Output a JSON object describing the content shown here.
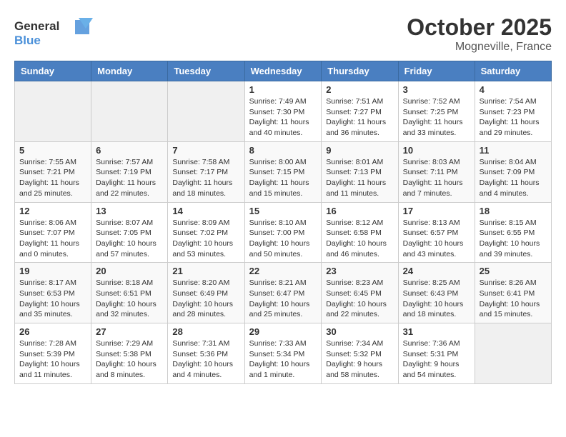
{
  "header": {
    "logo_general": "General",
    "logo_blue": "Blue",
    "month": "October 2025",
    "location": "Mogneville, France"
  },
  "weekdays": [
    "Sunday",
    "Monday",
    "Tuesday",
    "Wednesday",
    "Thursday",
    "Friday",
    "Saturday"
  ],
  "weeks": [
    [
      {
        "day": "",
        "info": ""
      },
      {
        "day": "",
        "info": ""
      },
      {
        "day": "",
        "info": ""
      },
      {
        "day": "1",
        "info": "Sunrise: 7:49 AM\nSunset: 7:30 PM\nDaylight: 11 hours and 40 minutes."
      },
      {
        "day": "2",
        "info": "Sunrise: 7:51 AM\nSunset: 7:27 PM\nDaylight: 11 hours and 36 minutes."
      },
      {
        "day": "3",
        "info": "Sunrise: 7:52 AM\nSunset: 7:25 PM\nDaylight: 11 hours and 33 minutes."
      },
      {
        "day": "4",
        "info": "Sunrise: 7:54 AM\nSunset: 7:23 PM\nDaylight: 11 hours and 29 minutes."
      }
    ],
    [
      {
        "day": "5",
        "info": "Sunrise: 7:55 AM\nSunset: 7:21 PM\nDaylight: 11 hours and 25 minutes."
      },
      {
        "day": "6",
        "info": "Sunrise: 7:57 AM\nSunset: 7:19 PM\nDaylight: 11 hours and 22 minutes."
      },
      {
        "day": "7",
        "info": "Sunrise: 7:58 AM\nSunset: 7:17 PM\nDaylight: 11 hours and 18 minutes."
      },
      {
        "day": "8",
        "info": "Sunrise: 8:00 AM\nSunset: 7:15 PM\nDaylight: 11 hours and 15 minutes."
      },
      {
        "day": "9",
        "info": "Sunrise: 8:01 AM\nSunset: 7:13 PM\nDaylight: 11 hours and 11 minutes."
      },
      {
        "day": "10",
        "info": "Sunrise: 8:03 AM\nSunset: 7:11 PM\nDaylight: 11 hours and 7 minutes."
      },
      {
        "day": "11",
        "info": "Sunrise: 8:04 AM\nSunset: 7:09 PM\nDaylight: 11 hours and 4 minutes."
      }
    ],
    [
      {
        "day": "12",
        "info": "Sunrise: 8:06 AM\nSunset: 7:07 PM\nDaylight: 11 hours and 0 minutes."
      },
      {
        "day": "13",
        "info": "Sunrise: 8:07 AM\nSunset: 7:05 PM\nDaylight: 10 hours and 57 minutes."
      },
      {
        "day": "14",
        "info": "Sunrise: 8:09 AM\nSunset: 7:02 PM\nDaylight: 10 hours and 53 minutes."
      },
      {
        "day": "15",
        "info": "Sunrise: 8:10 AM\nSunset: 7:00 PM\nDaylight: 10 hours and 50 minutes."
      },
      {
        "day": "16",
        "info": "Sunrise: 8:12 AM\nSunset: 6:58 PM\nDaylight: 10 hours and 46 minutes."
      },
      {
        "day": "17",
        "info": "Sunrise: 8:13 AM\nSunset: 6:57 PM\nDaylight: 10 hours and 43 minutes."
      },
      {
        "day": "18",
        "info": "Sunrise: 8:15 AM\nSunset: 6:55 PM\nDaylight: 10 hours and 39 minutes."
      }
    ],
    [
      {
        "day": "19",
        "info": "Sunrise: 8:17 AM\nSunset: 6:53 PM\nDaylight: 10 hours and 35 minutes."
      },
      {
        "day": "20",
        "info": "Sunrise: 8:18 AM\nSunset: 6:51 PM\nDaylight: 10 hours and 32 minutes."
      },
      {
        "day": "21",
        "info": "Sunrise: 8:20 AM\nSunset: 6:49 PM\nDaylight: 10 hours and 28 minutes."
      },
      {
        "day": "22",
        "info": "Sunrise: 8:21 AM\nSunset: 6:47 PM\nDaylight: 10 hours and 25 minutes."
      },
      {
        "day": "23",
        "info": "Sunrise: 8:23 AM\nSunset: 6:45 PM\nDaylight: 10 hours and 22 minutes."
      },
      {
        "day": "24",
        "info": "Sunrise: 8:25 AM\nSunset: 6:43 PM\nDaylight: 10 hours and 18 minutes."
      },
      {
        "day": "25",
        "info": "Sunrise: 8:26 AM\nSunset: 6:41 PM\nDaylight: 10 hours and 15 minutes."
      }
    ],
    [
      {
        "day": "26",
        "info": "Sunrise: 7:28 AM\nSunset: 5:39 PM\nDaylight: 10 hours and 11 minutes."
      },
      {
        "day": "27",
        "info": "Sunrise: 7:29 AM\nSunset: 5:38 PM\nDaylight: 10 hours and 8 minutes."
      },
      {
        "day": "28",
        "info": "Sunrise: 7:31 AM\nSunset: 5:36 PM\nDaylight: 10 hours and 4 minutes."
      },
      {
        "day": "29",
        "info": "Sunrise: 7:33 AM\nSunset: 5:34 PM\nDaylight: 10 hours and 1 minute."
      },
      {
        "day": "30",
        "info": "Sunrise: 7:34 AM\nSunset: 5:32 PM\nDaylight: 9 hours and 58 minutes."
      },
      {
        "day": "31",
        "info": "Sunrise: 7:36 AM\nSunset: 5:31 PM\nDaylight: 9 hours and 54 minutes."
      },
      {
        "day": "",
        "info": ""
      }
    ]
  ]
}
